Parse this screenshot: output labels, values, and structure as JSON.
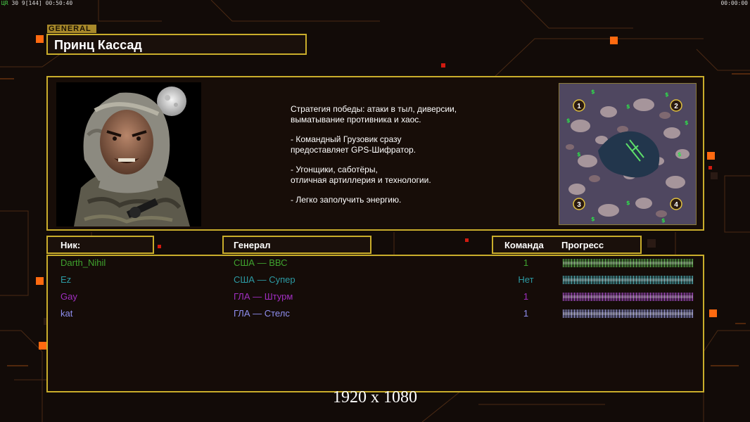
{
  "hud": {
    "left_prefix": "ЦR",
    "left_stats": " 30 9[144] 00:50:40",
    "right_clock": "00:00:00"
  },
  "general_tag": "GENERAL",
  "general_name": "Принц Кассад",
  "description": [
    "Стратегия победы: атаки в тыл, диверсии,\n выматывание противника и хаос.",
    "- Командный Грузовик сразу\nпредоставляет GPS-Шифратор.",
    "- Угонщики, саботёры,\nотличная артиллерия и технологии.",
    "- Легко заполучить энергию."
  ],
  "minimap": {
    "start_positions": [
      "1",
      "2",
      "3",
      "4"
    ],
    "money_symbol": "$"
  },
  "columns": {
    "nick": "Ник:",
    "general": "Генерал",
    "team": "Команда",
    "progress": "Прогресс"
  },
  "players": [
    {
      "nick": "Darth_Nihil",
      "general": "США — ВВС",
      "team": "1",
      "color": "#3fa22e",
      "progress": 1.0
    },
    {
      "nick": "Ez",
      "general": "США — Супер",
      "team": "Нет",
      "color": "#2c9aa3",
      "progress": 1.0
    },
    {
      "nick": "Gay",
      "general": "ГЛА — Штурм",
      "team": "1",
      "color": "#a02ec0",
      "progress": 1.0
    },
    {
      "nick": "kat",
      "general": "ГЛА — Стелс",
      "team": "1",
      "color": "#8f8ff0",
      "progress": 1.0
    }
  ],
  "resolution_label": "1920 x 1080",
  "colors": {
    "frame": "#c9ad2b",
    "accent_orange": "#ff6a10",
    "background": "#120b08"
  }
}
